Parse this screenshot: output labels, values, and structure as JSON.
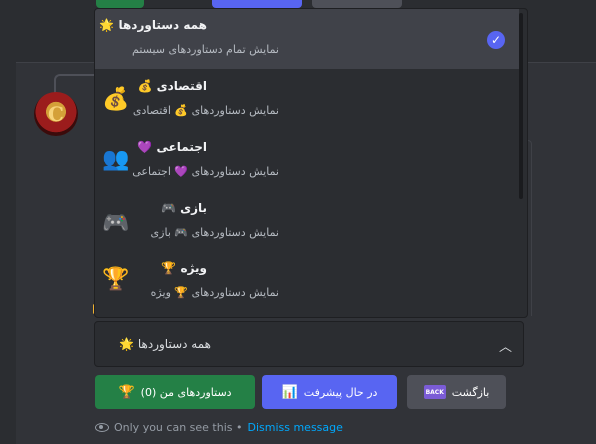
{
  "colors": {
    "accent": "#5865f2",
    "success": "#248046",
    "link": "#00a8fc",
    "background": "#313338",
    "menu": "#2b2d31"
  },
  "avatar": {
    "letter": "C"
  },
  "dropdown": {
    "options": [
      {
        "icon": "",
        "title": "همه دستاوردها 🌟",
        "description": "نمایش تمام دستاوردهای سیستم",
        "selected": true
      },
      {
        "icon": "💰",
        "title": "اقتصادی 💰",
        "description": "نمایش دستاوردهای 💰 اقتصادی",
        "selected": false
      },
      {
        "icon": "👥",
        "title": "اجتماعی 💜",
        "description": "نمایش دستاوردهای 💜 اجتماعی",
        "selected": false
      },
      {
        "icon": "🎮",
        "title": "بازی 🎮",
        "description": "نمایش دستاوردهای 🎮 بازی",
        "selected": false
      },
      {
        "icon": "🏆",
        "title": "ویژه 🏆",
        "description": "نمایش دستاوردهای 🏆 ویژه",
        "selected": false
      }
    ],
    "check_icon": "check-circle-icon"
  },
  "select": {
    "value": "همه دستاوردها 🌟",
    "chevron": "chevron-up-icon"
  },
  "buttons": {
    "my_achievements": {
      "label": "دستاوردهای من (0)",
      "icon": "🏆"
    },
    "in_progress": {
      "label": "در حال پیشرفت",
      "icon": "📊"
    },
    "back": {
      "label": "بازگشت",
      "icon_text": "BACK"
    }
  },
  "footer": {
    "notice": "Only you can see this •",
    "dismiss": "Dismiss message"
  }
}
